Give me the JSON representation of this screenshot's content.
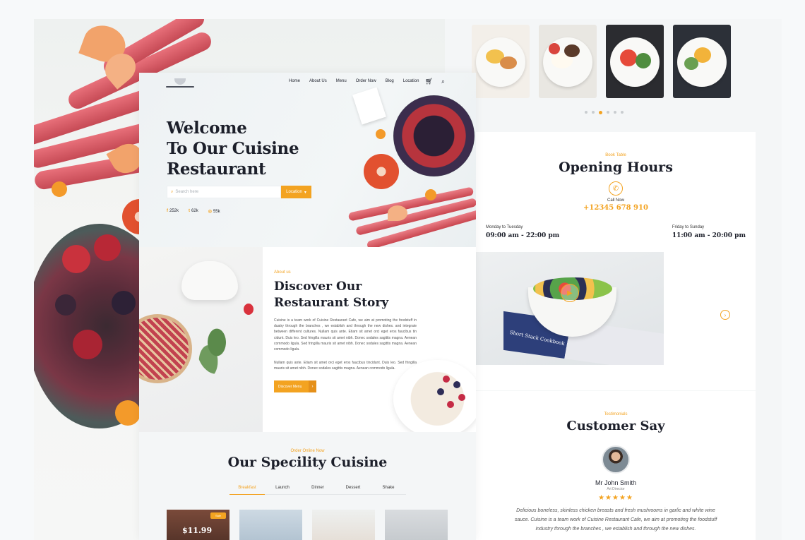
{
  "nav": {
    "items": [
      "Home",
      "About Us",
      "Menu",
      "Order Now",
      "Blog",
      "Location"
    ]
  },
  "hero": {
    "title_lines": [
      "Welcome",
      "To Our Cuisine",
      "Restaurant"
    ],
    "search_placeholder": "Search here",
    "location_button": "Location",
    "socials": [
      {
        "icon": "facebook-icon",
        "glyph": "f",
        "count": "252k"
      },
      {
        "icon": "twitter-icon",
        "glyph": "t",
        "count": "62k"
      },
      {
        "icon": "instagram-icon",
        "glyph": "◎",
        "count": "55k"
      }
    ]
  },
  "about": {
    "eyebrow": "About us",
    "title_lines": [
      "Discover Our",
      "Restaurant Story"
    ],
    "paragraph1": "Cuisine is a team work of Cuisine Restaurant Cafe, we aim at promoting the foodstuff in duatry through the branches , we establish and through the new dishes. and integrate between different cultures. Nullam quis ante. Etiam sit amet orci eget eros faucibus tin cidunt. Duis leo. Sed fringilla mauris sit amet nibh. Donec sodales sagittis magna. Aenean commodo ligula. Sed fringilla mauris sit amet nibh. Donec sodales sagittis magna. Aenean commodo ligula.",
    "paragraph2": "Nullam quis ante. Etiam sit amet orci eget eros faucibus tincidunt. Duis leo. Sed fringilla mauris sit amet nibh. Donec sodales sagittis magna. Aenean commodo ligula.",
    "button": "Discover Menu"
  },
  "specialty": {
    "eyebrow": "Order Online Now",
    "title": "Our Specility Cuisine",
    "tabs": [
      "Breakfast",
      "Launch",
      "Dinner",
      "Dessert",
      "Shake"
    ],
    "active_tab": "Breakfast",
    "first_card_price": "$11.99",
    "first_card_badge": "Sale"
  },
  "opening_hours": {
    "eyebrow": "Book Table",
    "title": "Opening Hours",
    "call_label": "Call Now",
    "phone": "+12345 678 910",
    "weekday_label": "Monday to Tuesday",
    "weekday_hours": "09:00 am - 22:00 pm",
    "weekend_label": "Friday to Sunday",
    "weekend_hours": "11:00 am - 20:00 pm",
    "video_book_text": "Short Stack Cookbook"
  },
  "testimonials": {
    "eyebrow": "Testimonials",
    "title": "Customer Say",
    "name": "Mr John Smith",
    "role": "Art Director",
    "rating": 5,
    "stars": "★★★★★",
    "quote_lines": [
      "Delicious boneless, skinless chicken breasts and fresh mushrooms in garlic and white wine",
      "sauce. Cuisine is a team work of Cuisine Restaurant Cafe, we aim at promoting the foodstuff",
      "industry through the branches , we establish and through the new dishes."
    ]
  },
  "colors": {
    "accent": "#f3a321",
    "heading": "#1c1f2a"
  }
}
